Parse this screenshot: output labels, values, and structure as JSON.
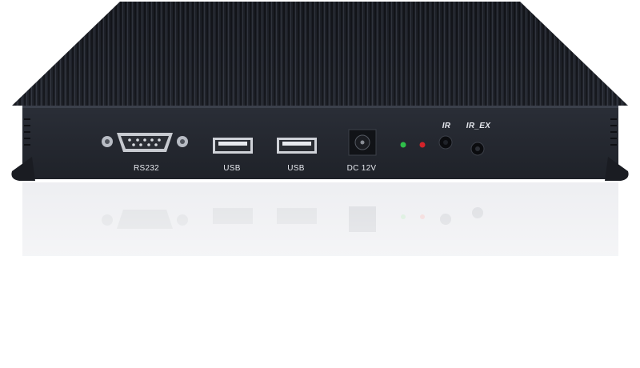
{
  "device": {
    "type": "fanless-embedded-pc",
    "body_color": "#23262f",
    "heatsink_color": "#15171d",
    "led_colors": [
      "#2fbf4a",
      "#d4232a"
    ],
    "ports": [
      {
        "kind": "serial-db9",
        "label": "RS232"
      },
      {
        "kind": "usb-a",
        "label": "USB"
      },
      {
        "kind": "usb-a",
        "label": "USB"
      },
      {
        "kind": "dc-jack",
        "label": "DC 12V"
      },
      {
        "kind": "ir-sensor",
        "label": "IR"
      },
      {
        "kind": "audio-jack",
        "label": "IR_EX"
      }
    ]
  }
}
